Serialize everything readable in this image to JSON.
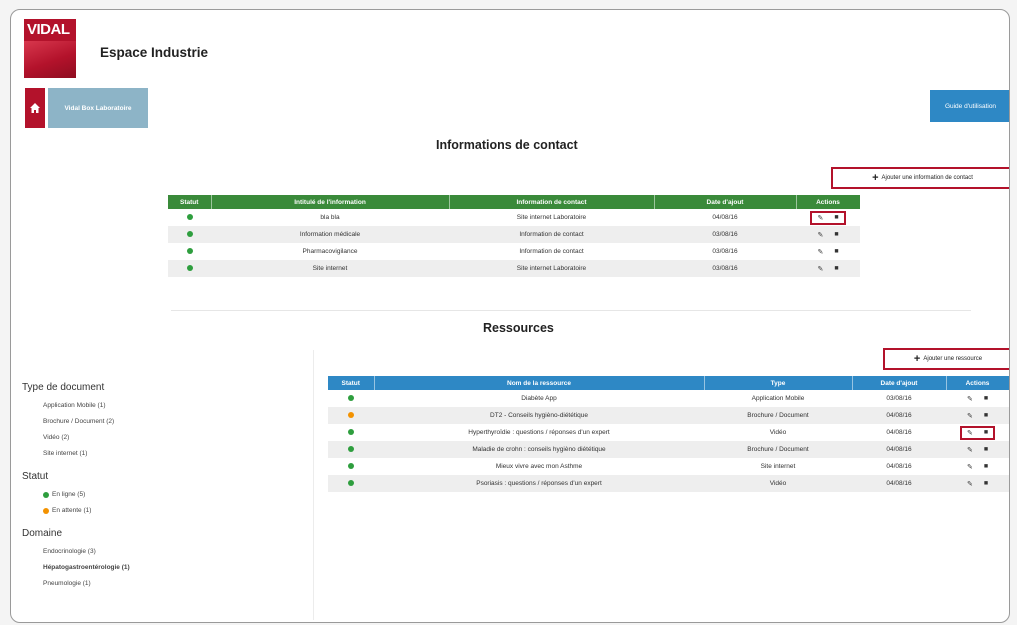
{
  "header": {
    "logo_text": "VIDAL",
    "app_title": "Espace Industrie",
    "nav_button": "Vidal Box Laboratoire",
    "guide_button": "Guide d'utilisation"
  },
  "contacts": {
    "title": "Informations de contact",
    "add_label": "Ajouter une information de contact",
    "headers": [
      "Statut",
      "Intitulé de l'information",
      "Information de contact",
      "Date d'ajout",
      "Actions"
    ],
    "rows": [
      {
        "status": "green",
        "label": "bla bla",
        "contact": "Site internet Laboratoire",
        "date": "04/08/16"
      },
      {
        "status": "green",
        "label": "Information médicale",
        "contact": "Information de contact",
        "date": "03/08/16"
      },
      {
        "status": "green",
        "label": "Pharmacovigilance",
        "contact": "Information de contact",
        "date": "03/08/16"
      },
      {
        "status": "green",
        "label": "Site internet",
        "contact": "Site internet Laboratoire",
        "date": "03/08/16"
      }
    ]
  },
  "resources": {
    "title": "Ressources",
    "add_label": "Ajouter une ressource",
    "headers": [
      "Statut",
      "Nom de la ressource",
      "Type",
      "Date d'ajout",
      "Actions"
    ],
    "rows": [
      {
        "status": "green",
        "name": "Diabète App",
        "type": "Application Mobile",
        "date": "03/08/16"
      },
      {
        "status": "orange",
        "name": "DT2 - Conseils hygièno-diététique",
        "type": "Brochure / Document",
        "date": "04/08/16"
      },
      {
        "status": "green",
        "name": "Hyperthyroïdie : questions / réponses d'un expert",
        "type": "Vidéo",
        "date": "04/08/16"
      },
      {
        "status": "green",
        "name": "Maladie de crohn : conseils hygièno diététique",
        "type": "Brochure / Document",
        "date": "04/08/16"
      },
      {
        "status": "green",
        "name": "Mieux vivre avec mon Asthme",
        "type": "Site internet",
        "date": "04/08/16"
      },
      {
        "status": "green",
        "name": "Psoriasis : questions / réponses d'un expert",
        "type": "Vidéo",
        "date": "04/08/16"
      }
    ]
  },
  "filters": {
    "type_title": "Type de document",
    "type_items": [
      "Application Mobile (1)",
      "Brochure / Document (2)",
      "Vidéo (2)",
      "Site internet (1)"
    ],
    "status_title": "Statut",
    "status_items": [
      "En ligne (5)",
      "En attente (1)"
    ],
    "domain_title": "Domaine",
    "domain_items": [
      "Endocrinologie (3)",
      "Hépatogastroentérologie (1)",
      "Pneumologie (1)"
    ]
  },
  "colors": {
    "brand_red": "#b3122b",
    "green_header": "#3a8a3a",
    "blue_header": "#2e88c5",
    "status_green": "#2e9e3e",
    "status_orange": "#f39200"
  },
  "icons": {
    "home": "home-icon",
    "add": "plus-icon",
    "edit": "pencil-icon",
    "delete": "trash-icon"
  }
}
